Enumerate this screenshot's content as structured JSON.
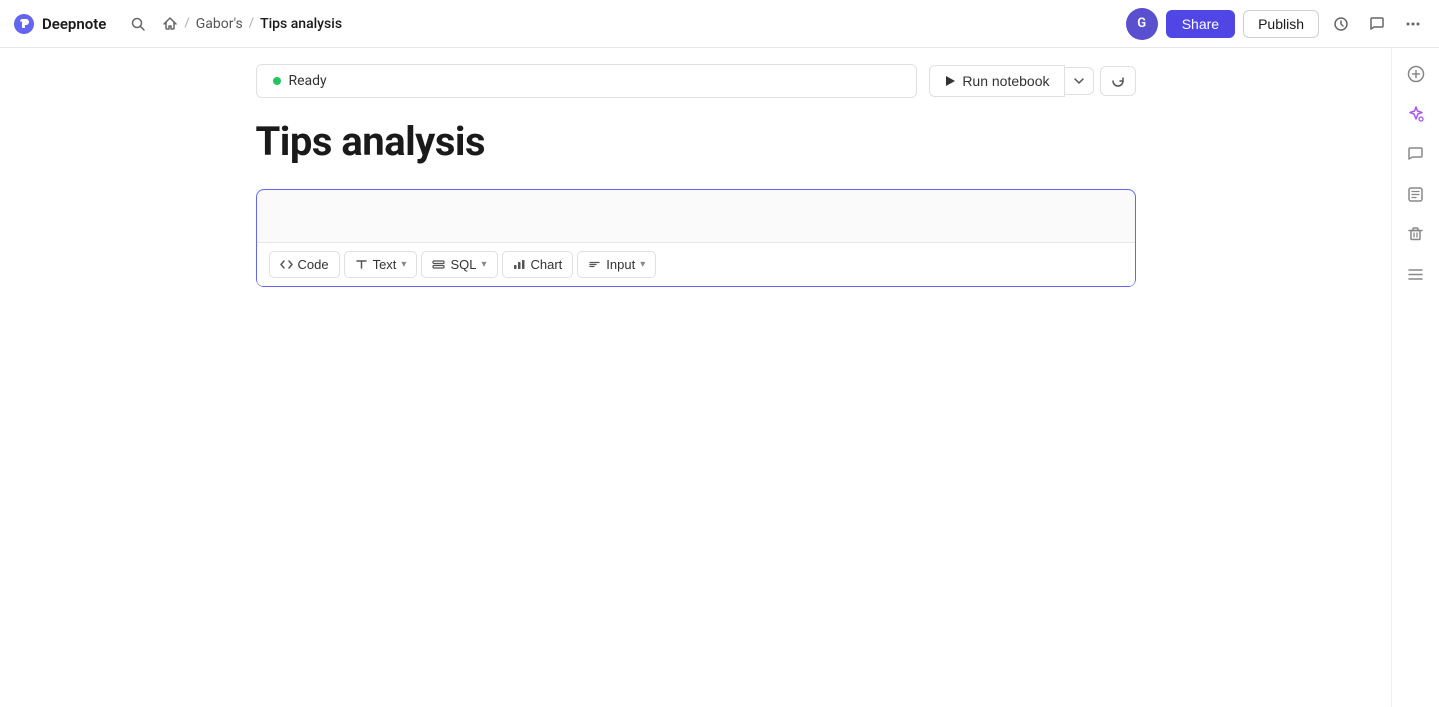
{
  "app": {
    "name": "Deepnote"
  },
  "topbar": {
    "search_title": "Search",
    "breadcrumb": {
      "home_label": "Home",
      "workspace": "Gabor's",
      "page": "Tips analysis"
    },
    "avatar_initials": "G",
    "share_label": "Share",
    "publish_label": "Publish"
  },
  "kernel": {
    "status_label": "Ready",
    "run_notebook_label": "Run notebook"
  },
  "notebook": {
    "title": "Tips analysis"
  },
  "cell": {
    "placeholder": ""
  },
  "toolbar": {
    "code_label": "Code",
    "text_label": "Text",
    "sql_label": "SQL",
    "chart_label": "Chart",
    "input_label": "Input"
  },
  "right_sidebar": {
    "add_icon": "+",
    "magic_icon": "✦",
    "comment_icon": "💬",
    "table_icon": "⊞",
    "delete_icon": "🗑",
    "menu_icon": "≡"
  }
}
